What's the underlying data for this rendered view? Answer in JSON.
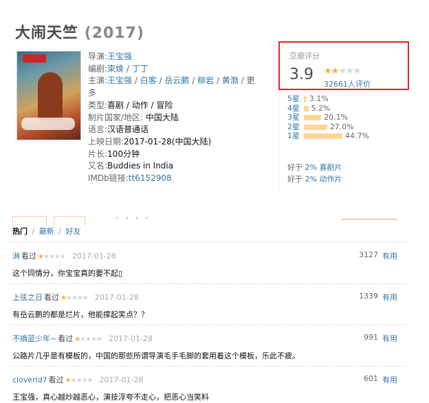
{
  "movie": {
    "title": "大闹天竺",
    "year": "(2017)"
  },
  "poster": {
    "icon": "movie-poster-image"
  },
  "info": {
    "director_label": "导演:",
    "director": "王宝强",
    "writer_label": "编剧:",
    "writers": [
      "束焕",
      "丁丁"
    ],
    "cast_label": "主演:",
    "cast": [
      "王宝强",
      "白客",
      "岳云鹏",
      "柳岩",
      "黄渤"
    ],
    "cast_more": "更",
    "cast_more2": "多",
    "genre_label": "类型:",
    "genres": "喜剧 / 动作 / 冒险",
    "country_label": "制片国家/地区:",
    "country": "中国大陆",
    "language_label": "语言:",
    "language": "汉语普通话",
    "release_label": "上映日期:",
    "release": "2017-01-28(中国大陆)",
    "runtime_label": "片长:",
    "runtime": "100分钟",
    "aka_label": "又名:",
    "aka": "Buddies in India",
    "imdb_label": "IMDb链接:",
    "imdb": "tt6152908"
  },
  "rating": {
    "label": "豆瓣评分",
    "score": "3.9",
    "stars_filled": 2,
    "stars_total": 5,
    "votes": "32661人评价",
    "distribution": [
      {
        "label": "5星",
        "percent": 3.1,
        "text": "3.1%"
      },
      {
        "label": "4星",
        "percent": 5.2,
        "text": "5.2%"
      },
      {
        "label": "3星",
        "percent": 20.1,
        "text": "20.1%"
      },
      {
        "label": "2星",
        "percent": 27.0,
        "text": "27.0%"
      },
      {
        "label": "1星",
        "percent": 44.7,
        "text": "44.7%"
      }
    ],
    "better_than": [
      {
        "prefix": "好于 ",
        "value": "2% 喜剧片"
      },
      {
        "prefix": "好于 ",
        "value": "2% 动作片"
      }
    ]
  },
  "tabs": {
    "hot": "热门",
    "latest": "最新",
    "friends": "好友",
    "sep": "/"
  },
  "comments": [
    {
      "user": "淋",
      "watched": "看过",
      "stars": 1,
      "date": "2017-01-28",
      "votes": "3127",
      "useful": "有用",
      "text": "这个同情分，你宝宝真的要不起▯"
    },
    {
      "user": "上弦之日",
      "watched": "看过",
      "stars": 1,
      "date": "2017-01-28",
      "votes": "1339",
      "useful": "有用",
      "text": "有岳云鹏的都是烂片，他能撑起笑点？？"
    },
    {
      "user": "不摘蓝少年~",
      "watched": "看过",
      "stars": 1,
      "date": "2017-01-28",
      "votes": "991",
      "useful": "有用",
      "text": "公路片几乎是有模板的，中国的那些所谓导演毛手毛脚的套用着这个模板，乐此不疲。"
    },
    {
      "user": "cloverld7",
      "watched": "看过",
      "stars": 1,
      "date": "2017-01-28",
      "votes": "601",
      "useful": "有用",
      "text": "王宝强，真心越炒越恶心，演技浮夸不走心，把恶心当笑料"
    }
  ]
}
